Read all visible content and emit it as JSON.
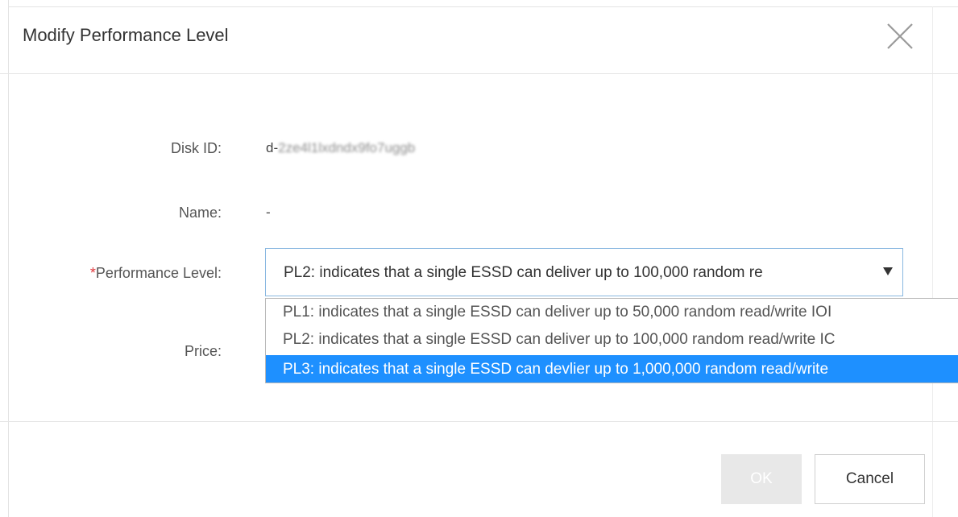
{
  "dialog": {
    "title": "Modify Performance Level",
    "close_icon": "close-icon"
  },
  "form": {
    "disk_id": {
      "label": "Disk ID:",
      "value_prefix": "d-",
      "value_obscured": "2ze4l1lxdndx9fo7uggb"
    },
    "name": {
      "label": "Name:",
      "value": "-"
    },
    "performance_level": {
      "required_mark": "*",
      "label": "Performance Level:",
      "selected": "PL2: indicates that a single ESSD can deliver up to 100,000 random re",
      "options": [
        "PL1: indicates that a single ESSD can deliver up to 50,000 random read/write IOI",
        "PL2: indicates that a single ESSD can deliver up to 100,000 random read/write IC",
        "PL3: indicates that a single ESSD can devlier up to 1,000,000 random read/write"
      ],
      "highlighted_index": 2
    },
    "price": {
      "label": "Price:"
    }
  },
  "footer": {
    "ok_label": "OK",
    "cancel_label": "Cancel"
  },
  "colors": {
    "highlight": "#1e90ff",
    "required": "#e0393e",
    "select_border": "#88b7e0",
    "ok_disabled_bg": "#e8e8e8"
  }
}
